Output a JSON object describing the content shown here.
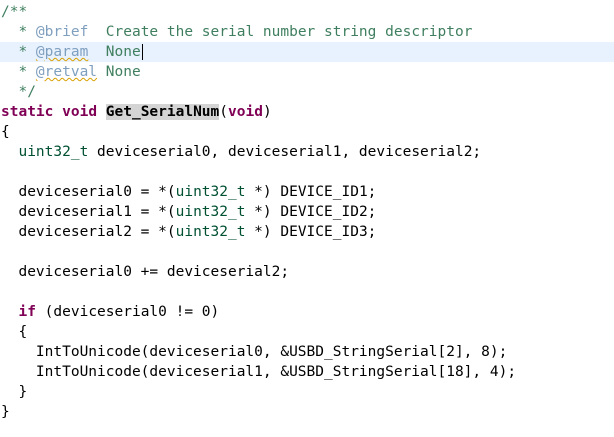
{
  "editor": {
    "colors": {
      "comment": "#3f7f5f",
      "doc_tag": "#7f9fbf",
      "keyword": "#7f0055",
      "type": "#005032",
      "current_line_bg": "#e8f2fe",
      "function_highlight_bg": "#d4d4d4"
    },
    "current_line_index": 2,
    "lines": [
      {
        "tokens": [
          {
            "t": "/**",
            "c": "comment"
          }
        ]
      },
      {
        "tokens": [
          {
            "t": "  * ",
            "c": "comment"
          },
          {
            "t": "@brief",
            "c": "doctag"
          },
          {
            "t": "  Create the serial number string descriptor",
            "c": "comment"
          }
        ]
      },
      {
        "tokens": [
          {
            "t": "  * ",
            "c": "comment"
          },
          {
            "t": "@param",
            "c": "doctag-ul"
          },
          {
            "t": "  None",
            "c": "comment"
          }
        ],
        "caret": true
      },
      {
        "tokens": [
          {
            "t": "  * ",
            "c": "comment"
          },
          {
            "t": "@retval",
            "c": "doctag-ul"
          },
          {
            "t": " None",
            "c": "comment"
          }
        ]
      },
      {
        "tokens": [
          {
            "t": "  */",
            "c": "comment"
          }
        ]
      },
      {
        "tokens": [
          {
            "t": "static",
            "c": "kw"
          },
          {
            "t": " ",
            "c": "plain"
          },
          {
            "t": "void",
            "c": "kw"
          },
          {
            "t": " ",
            "c": "plain"
          },
          {
            "t": "Get_SerialNum",
            "c": "fndecl"
          },
          {
            "t": "(",
            "c": "plain"
          },
          {
            "t": "void",
            "c": "kw"
          },
          {
            "t": ")",
            "c": "plain"
          }
        ]
      },
      {
        "tokens": [
          {
            "t": "{",
            "c": "plain"
          }
        ]
      },
      {
        "tokens": [
          {
            "t": "  ",
            "c": "plain"
          },
          {
            "t": "uint32_t",
            "c": "type"
          },
          {
            "t": " deviceserial0, deviceserial1, deviceserial2;",
            "c": "plain"
          }
        ]
      },
      {
        "tokens": [
          {
            "t": "",
            "c": "plain"
          }
        ]
      },
      {
        "tokens": [
          {
            "t": "  deviceserial0 = *(",
            "c": "plain"
          },
          {
            "t": "uint32_t",
            "c": "type"
          },
          {
            "t": " *) DEVICE_ID1;",
            "c": "plain"
          }
        ]
      },
      {
        "tokens": [
          {
            "t": "  deviceserial1 = *(",
            "c": "plain"
          },
          {
            "t": "uint32_t",
            "c": "type"
          },
          {
            "t": " *) DEVICE_ID2;",
            "c": "plain"
          }
        ]
      },
      {
        "tokens": [
          {
            "t": "  deviceserial2 = *(",
            "c": "plain"
          },
          {
            "t": "uint32_t",
            "c": "type"
          },
          {
            "t": " *) DEVICE_ID3;",
            "c": "plain"
          }
        ]
      },
      {
        "tokens": [
          {
            "t": "",
            "c": "plain"
          }
        ]
      },
      {
        "tokens": [
          {
            "t": "  deviceserial0 += deviceserial2;",
            "c": "plain"
          }
        ]
      },
      {
        "tokens": [
          {
            "t": "",
            "c": "plain"
          }
        ]
      },
      {
        "tokens": [
          {
            "t": "  ",
            "c": "plain"
          },
          {
            "t": "if",
            "c": "kw"
          },
          {
            "t": " (deviceserial0 != 0)",
            "c": "plain"
          }
        ]
      },
      {
        "tokens": [
          {
            "t": "  {",
            "c": "plain"
          }
        ]
      },
      {
        "tokens": [
          {
            "t": "    IntToUnicode(deviceserial0, &USBD_StringSerial[2], 8);",
            "c": "plain"
          }
        ]
      },
      {
        "tokens": [
          {
            "t": "    IntToUnicode(deviceserial1, &USBD_StringSerial[18], 4);",
            "c": "plain"
          }
        ]
      },
      {
        "tokens": [
          {
            "t": "  }",
            "c": "plain"
          }
        ]
      },
      {
        "tokens": [
          {
            "t": "}",
            "c": "plain"
          }
        ]
      }
    ]
  }
}
